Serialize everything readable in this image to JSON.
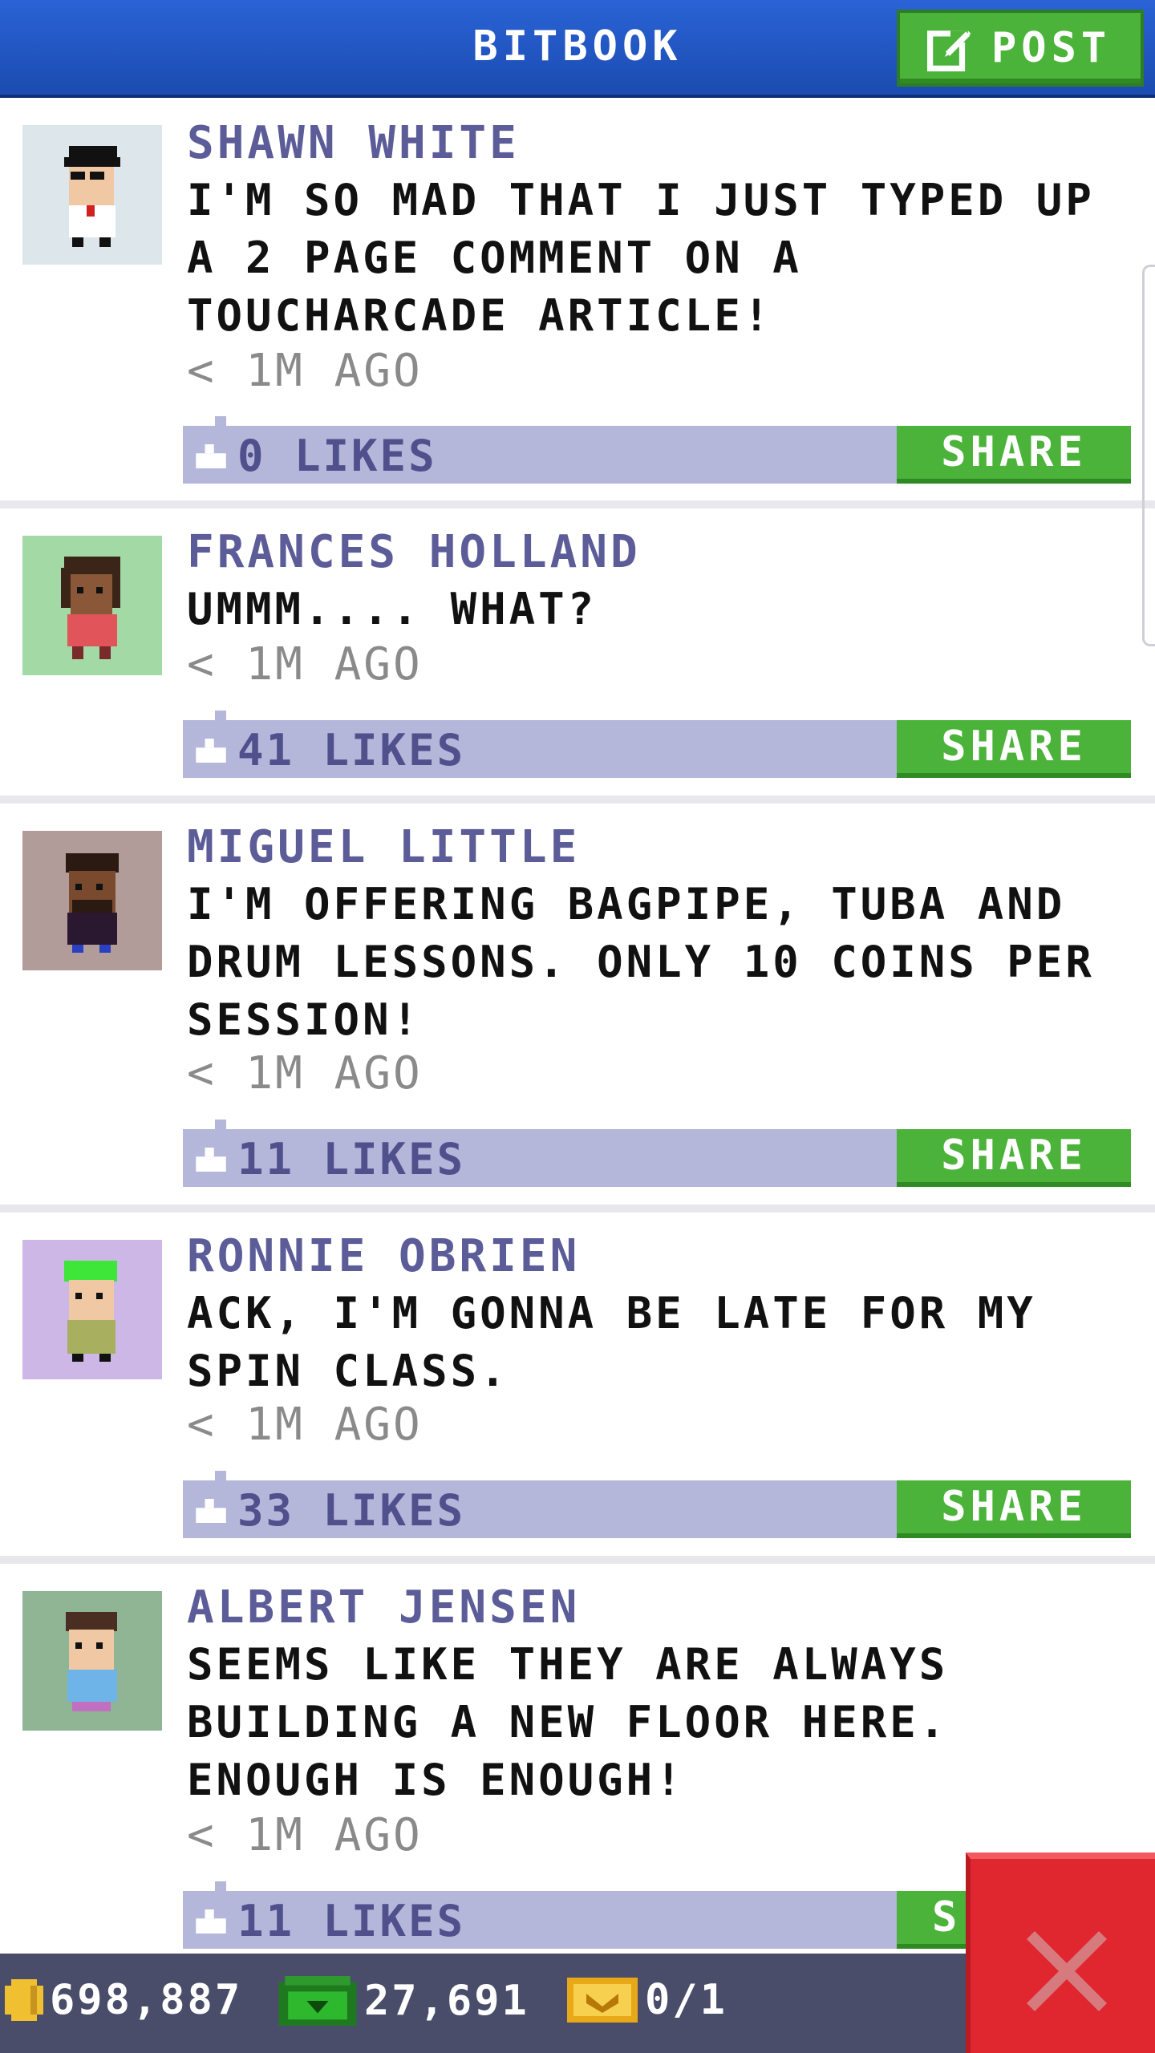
{
  "header": {
    "title": "BITBOOK",
    "post_label": "POST"
  },
  "posts": [
    {
      "name": "SHAWN WHITE",
      "text": "I'M SO MAD THAT I JUST TYPED UP A 2 PAGE COMMENT ON A TOUCHARCADE ARTICLE!",
      "time": "< 1M AGO",
      "likes": "0 LIKES",
      "share_label": "SHARE",
      "avatar_bg": "#dde6ea"
    },
    {
      "name": "FRANCES HOLLAND",
      "text": "UMMM....  WHAT?",
      "time": "< 1M AGO",
      "likes": "41 LIKES",
      "share_label": "SHARE",
      "avatar_bg": "#a3d9a4"
    },
    {
      "name": "MIGUEL LITTLE",
      "text": "I'M OFFERING BAGPIPE, TUBA AND DRUM LESSONS. ONLY 10 COINS PER SESSION!",
      "time": "< 1M AGO",
      "likes": "11 LIKES",
      "share_label": "SHARE",
      "avatar_bg": "#b29c9a"
    },
    {
      "name": "RONNIE OBRIEN",
      "text": "ACK, I'M GONNA BE LATE FOR MY SPIN CLASS.",
      "time": "< 1M AGO",
      "likes": "33 LIKES",
      "share_label": "SHARE",
      "avatar_bg": "#ccb7e6"
    },
    {
      "name": "ALBERT JENSEN",
      "text": "SEEMS LIKE THEY ARE ALWAYS BUILDING A NEW FLOOR HERE. ENOUGH IS ENOUGH!",
      "time": "< 1M AGO",
      "likes": "11 LIKES",
      "share_label": "S",
      "avatar_bg": "#8fb595"
    }
  ],
  "status": {
    "coins": "698,887",
    "bux": "27,691",
    "tickets": "0/1"
  },
  "colors": {
    "header_blue": "#1f50b8",
    "share_green": "#4bb33a",
    "likes_bar": "#b4b6da",
    "close_red": "#e0262e"
  }
}
